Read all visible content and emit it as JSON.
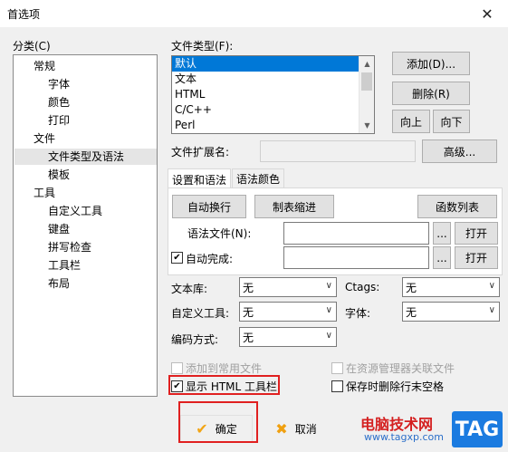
{
  "window": {
    "title": "首选项",
    "close_glyph": "✕"
  },
  "category": {
    "label": "分类(C)",
    "items": [
      {
        "label": "常规",
        "level": 0
      },
      {
        "label": "字体",
        "level": 1
      },
      {
        "label": "颜色",
        "level": 1
      },
      {
        "label": "打印",
        "level": 1
      },
      {
        "label": "文件",
        "level": 0
      },
      {
        "label": "文件类型及语法",
        "level": 1,
        "selected": true
      },
      {
        "label": "模板",
        "level": 1
      },
      {
        "label": "工具",
        "level": 0
      },
      {
        "label": "自定义工具",
        "level": 1
      },
      {
        "label": "键盘",
        "level": 1
      },
      {
        "label": "拼写检查",
        "level": 1
      },
      {
        "label": "工具栏",
        "level": 1
      },
      {
        "label": "布局",
        "level": 1
      }
    ]
  },
  "filetype": {
    "label": "文件类型(F):",
    "items": [
      "默认",
      "文本",
      "HTML",
      "C/C++",
      "Perl"
    ],
    "selected": "默认",
    "add_button": "添加(D)...",
    "delete_button": "删除(R)",
    "up_button": "向上",
    "down_button": "向下",
    "ext_label": "文件扩展名:",
    "advanced_button": "高级..."
  },
  "tabs": {
    "settings": "设置和语法",
    "colors": "语法颜色"
  },
  "panel": {
    "autowrap_button": "自动换行",
    "tab_indent_button": "制表缩进",
    "function_list_button": "函数列表",
    "syntax_file_label": "语法文件(N):",
    "ellipsis": "...",
    "open_button": "打开",
    "autocomplete_label": "自动完成:",
    "autocomplete_checked": true
  },
  "options": {
    "library_label": "文本库:",
    "library_value": "无",
    "ctags_label": "Ctags:",
    "ctags_value": "无",
    "custom_tools_label": "自定义工具:",
    "custom_tools_value": "无",
    "font_label": "字体:",
    "font_value": "无",
    "encoding_label": "编码方式:",
    "encoding_value": "无",
    "add_common_label": "添加到常用文件",
    "associate_label": "在资源管理器关联文件",
    "show_html_toolbar_label": "显示 HTML 工具栏",
    "show_html_toolbar_checked": true,
    "trim_trailing_label": "保存时删除行末空格",
    "trim_trailing_checked": false
  },
  "footer": {
    "ok_button": "确定",
    "cancel_button": "取消"
  },
  "watermark": {
    "site_name": "电脑技术网",
    "site_url": "www.tagxp.com",
    "badge": "TAG"
  },
  "colors": {
    "selection": "#0078d7",
    "highlight_box": "#e02020",
    "check_mark": "#f2a516",
    "cancel_x": "#f0a010"
  }
}
